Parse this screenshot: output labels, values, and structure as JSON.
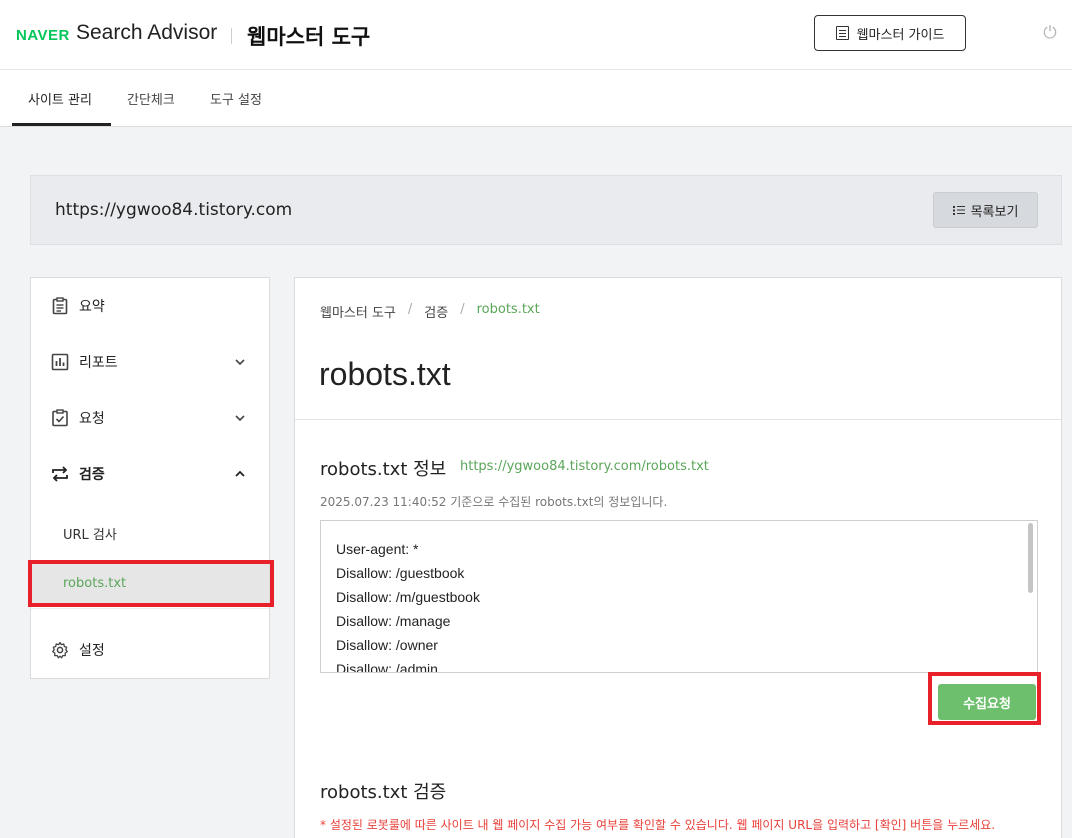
{
  "header": {
    "logo": "NAVER",
    "brand": "Search Advisor",
    "tool_title": "웹마스터 도구",
    "guide_button": "웹마스터 가이드",
    "power_glyph": "⏻"
  },
  "tabs": [
    {
      "label": "사이트 관리",
      "active": true
    },
    {
      "label": "간단체크",
      "active": false
    },
    {
      "label": "도구 설정",
      "active": false
    }
  ],
  "site": {
    "url": "https://ygwoo84.tistory.com",
    "list_button": "목록보기"
  },
  "sidebar": {
    "items": [
      {
        "label": "요약",
        "icon": "clipboard-icon"
      },
      {
        "label": "리포트",
        "icon": "bar-chart-icon",
        "expanded": false
      },
      {
        "label": "요청",
        "icon": "checklist-icon",
        "expanded": false
      },
      {
        "label": "검증",
        "icon": "swap-arrows-icon",
        "expanded": true
      },
      {
        "label": "설정",
        "icon": "gear-icon"
      }
    ],
    "sub_items": [
      {
        "label": "URL 검사",
        "active": false
      },
      {
        "label": "robots.txt",
        "active": true
      }
    ]
  },
  "main": {
    "breadcrumb": [
      "웹마스터 도구",
      "검증",
      "robots.txt"
    ],
    "breadcrumb_sep": "/",
    "page_title": "robots.txt",
    "info": {
      "title": "robots.txt 정보",
      "link": "https://ygwoo84.tistory.com/robots.txt",
      "note": "2025.07.23 11:40:52 기준으로 수집된 robots.txt의 정보입니다.",
      "lines": [
        "User-agent: *",
        "Disallow: /guestbook",
        "Disallow: /m/guestbook",
        "Disallow: /manage",
        "Disallow: /owner",
        "Disallow: /admin"
      ],
      "collect_button": "수집요청"
    },
    "verify": {
      "title": "robots.txt 검증",
      "note": "* 설정된 로봇룰에 따른 사이트 내 웹 페이지 수집 가능 여부를 확인할 수 있습니다. 웹 페이지 URL을 입력하고 [확인] 버튼을 누르세요."
    }
  },
  "colors": {
    "naver_green": "#03c75a",
    "accent_green": "#5aa65a",
    "button_green": "#6dbf6d",
    "highlight_red": "#e8202a",
    "warning_red": "#e8403a"
  }
}
